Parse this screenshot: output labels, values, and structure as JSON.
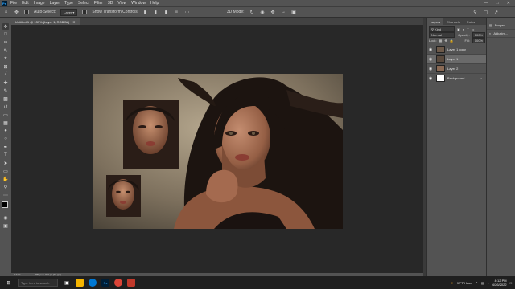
{
  "menu": [
    "File",
    "Edit",
    "Image",
    "Layer",
    "Type",
    "Select",
    "Filter",
    "3D",
    "View",
    "Window",
    "Help"
  ],
  "options_bar": {
    "auto_select_label": "Auto-Select:",
    "auto_select_value": "Layer",
    "show_transform_label": "Show Transform Controls",
    "mode_3d_label": "3D Mode:"
  },
  "document": {
    "tab_title": "Untitled-1 @ 131% (Layer 1, RGB/8#)",
    "zoom": "131%",
    "doc_size": "780 px x 480 px (72 ppi)"
  },
  "layers_panel": {
    "tabs": [
      "Layers",
      "Channels",
      "Paths"
    ],
    "kind_label": "Kind",
    "blend_mode": "Normal",
    "opacity_label": "Opacity:",
    "opacity_value": "100%",
    "lock_label": "Lock:",
    "fill_label": "Fill:",
    "fill_value": "100%",
    "layers": [
      {
        "name": "Layer 1 copy",
        "selected": false
      },
      {
        "name": "Layer 1",
        "selected": true
      },
      {
        "name": "Layer 2",
        "selected": false
      },
      {
        "name": "Background",
        "selected": false,
        "locked": true
      }
    ]
  },
  "side_panel": {
    "items": [
      "Proper...",
      "Adjustm..."
    ]
  },
  "taskbar": {
    "search_placeholder": "Type here to search",
    "weather": "92°F Haze",
    "time": "8:12 PM",
    "date": "4/26/2022"
  },
  "colors": {
    "ui_bg": "#535353",
    "canvas_bg": "#282828",
    "taskbar": "#1f1f1f",
    "ps_blue": "#31a8ff"
  }
}
